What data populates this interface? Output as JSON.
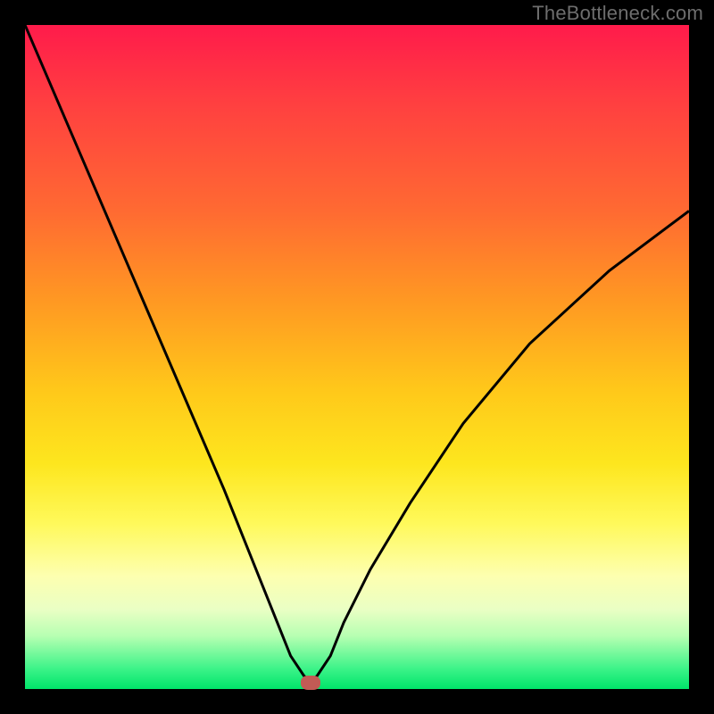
{
  "watermark": "TheBottleneck.com",
  "chart_data": {
    "type": "line",
    "title": "",
    "xlabel": "",
    "ylabel": "",
    "xlim": [
      0,
      100
    ],
    "ylim": [
      0,
      100
    ],
    "grid": false,
    "legend": false,
    "background_gradient": {
      "stops": [
        {
          "pos": 0,
          "color": "#ff1b4b"
        },
        {
          "pos": 12,
          "color": "#ff4040"
        },
        {
          "pos": 28,
          "color": "#ff6a32"
        },
        {
          "pos": 42,
          "color": "#ff9a22"
        },
        {
          "pos": 55,
          "color": "#ffc81a"
        },
        {
          "pos": 66,
          "color": "#fde61e"
        },
        {
          "pos": 75,
          "color": "#fff95a"
        },
        {
          "pos": 83,
          "color": "#fdffb0"
        },
        {
          "pos": 88,
          "color": "#eaffc4"
        },
        {
          "pos": 92,
          "color": "#b7ffb2"
        },
        {
          "pos": 97,
          "color": "#3bf388"
        },
        {
          "pos": 100,
          "color": "#00e46a"
        }
      ]
    },
    "series": [
      {
        "name": "bottleneck-curve",
        "x": [
          0,
          6,
          12,
          18,
          24,
          30,
          34,
          38,
          40,
          42,
          43,
          44,
          46,
          48,
          52,
          58,
          66,
          76,
          88,
          100
        ],
        "y": [
          100,
          86,
          72,
          58,
          44,
          30,
          20,
          10,
          5,
          2,
          1,
          2,
          5,
          10,
          18,
          28,
          40,
          52,
          63,
          72
        ]
      }
    ],
    "marker": {
      "name": "optimal-point",
      "x": 43,
      "y": 1,
      "color": "#c25b55"
    }
  }
}
